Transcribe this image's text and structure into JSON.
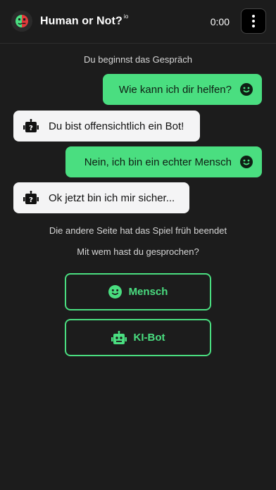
{
  "header": {
    "title": "Human or Not?",
    "title_suffix": "io",
    "timer": "0:00"
  },
  "chat": {
    "start_notice": "Du beginnst das Gespräch",
    "messages": [
      {
        "sender": "me",
        "text": "Wie kann ich dir helfen?"
      },
      {
        "sender": "bot",
        "text": "Du bist offensichtlich ein Bot!"
      },
      {
        "sender": "me",
        "text": "Nein, ich bin ein echter Mensch"
      },
      {
        "sender": "bot",
        "text": "Ok jetzt bin ich mir sicher..."
      }
    ],
    "end_notice": "Die andere Seite hat das Spiel früh beendet",
    "question": "Mit wem hast du gesprochen?"
  },
  "choices": {
    "human_label": "Mensch",
    "bot_label": "KI-Bot"
  },
  "colors": {
    "accent": "#4ade80",
    "background": "#1c1c1c",
    "logo_red": "#e23b3b",
    "logo_green": "#4ade80"
  },
  "icons": {
    "logo": "split-face-logo",
    "menu": "more-vertical-icon",
    "self": "smiley-icon",
    "partner": "robot-question-icon"
  }
}
